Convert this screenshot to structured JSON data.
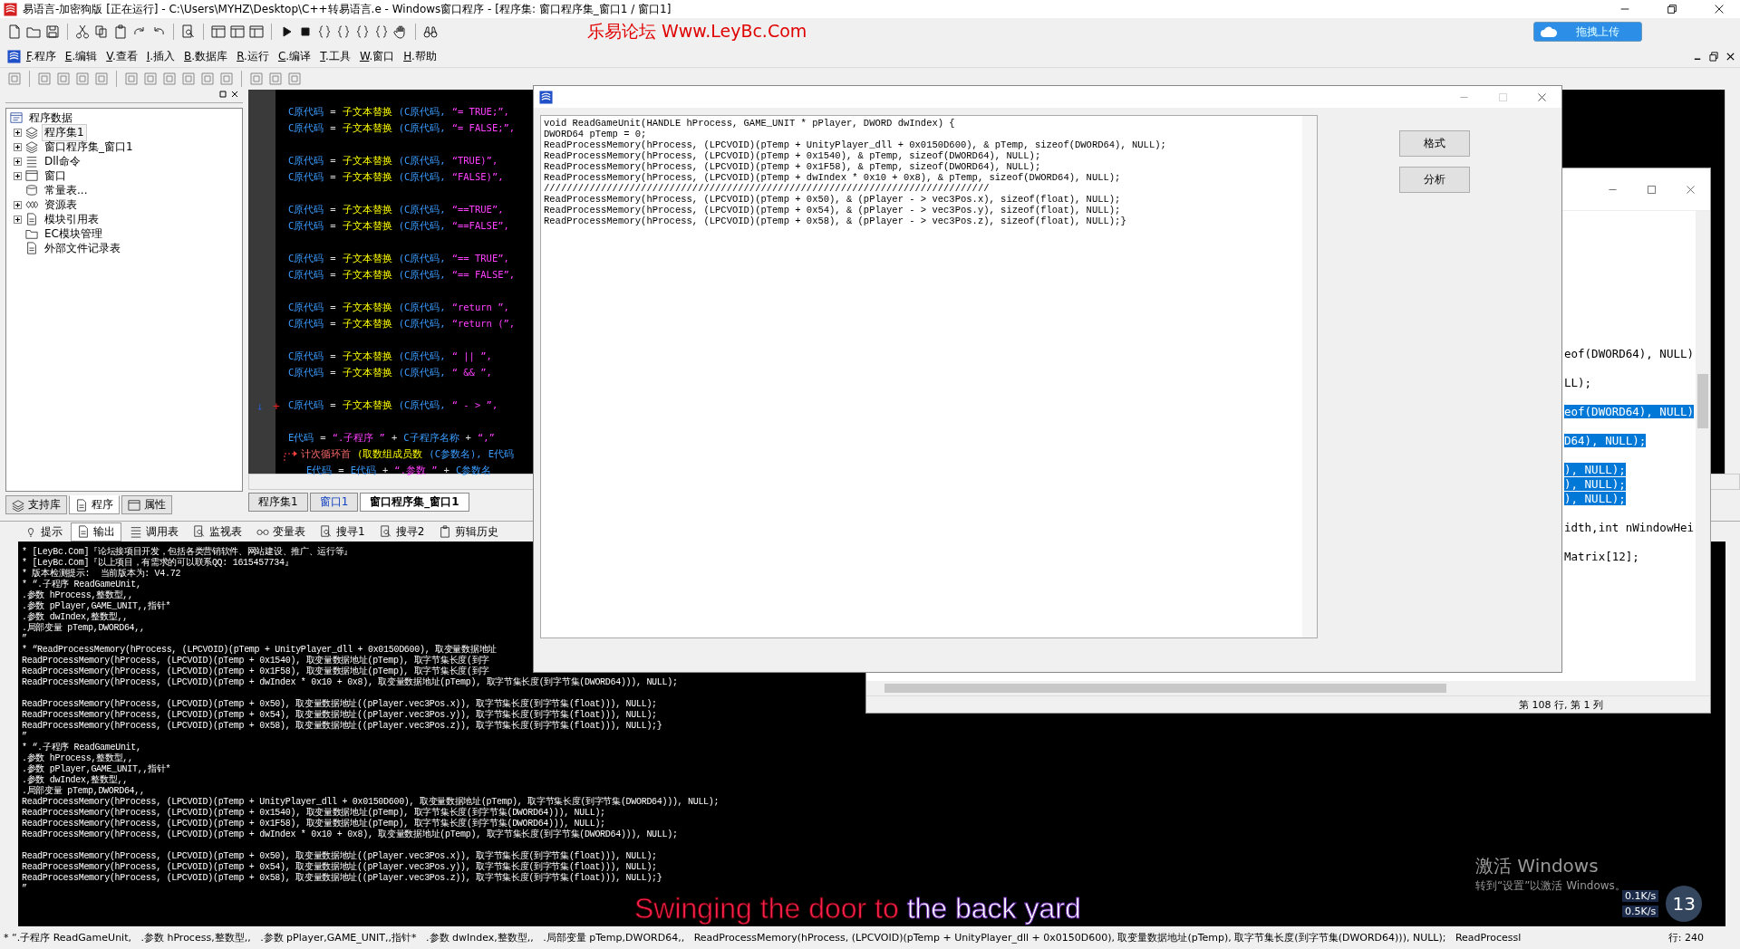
{
  "window": {
    "title": "易语言-加密狗版 [正在运行] - C:\\Users\\MYHZ\\Desktop\\C++转易语言.e - Windows窗口程序 - [程序集: 窗口程序集_窗口1 / 窗口1]"
  },
  "banner": "乐易论坛 Www.LeyBc.Com",
  "upload_button": "拖拽上传",
  "menu": [
    {
      "key": "F",
      "label": ".程序"
    },
    {
      "key": "E",
      "label": ".编辑"
    },
    {
      "key": "V",
      "label": ".查看"
    },
    {
      "key": "I",
      "label": ".插入"
    },
    {
      "key": "B",
      "label": ".数据库"
    },
    {
      "key": "R",
      "label": ".运行"
    },
    {
      "key": "C",
      "label": ".编译"
    },
    {
      "key": "T",
      "label": ".工具"
    },
    {
      "key": "W",
      "label": ".窗口"
    },
    {
      "key": "H",
      "label": ".帮助"
    }
  ],
  "tree": {
    "label": "程序数据",
    "expanded": true,
    "selected": false,
    "children": [
      {
        "label": "程序集1",
        "expanded": false,
        "selected": true
      },
      {
        "label": "窗口程序集_窗口1",
        "expanded": false,
        "selected": false
      },
      {
        "label": "Dll命令",
        "expanded": false,
        "selected": false
      },
      {
        "label": "窗口",
        "expanded": false,
        "selected": false
      },
      {
        "label": "常量表...",
        "selected": false
      },
      {
        "label": "资源表",
        "expanded": false,
        "selected": false
      },
      {
        "label": "模块引用表",
        "expanded": false,
        "selected": false
      },
      {
        "label": "EC模块管理",
        "selected": false
      },
      {
        "label": "外部文件记录表",
        "selected": false
      }
    ]
  },
  "panel_tabs": [
    {
      "label": "支持库",
      "selected": false
    },
    {
      "label": "程序",
      "selected": true
    },
    {
      "label": "属性",
      "selected": false
    }
  ],
  "code_blocks": [
    [
      {
        "kind": "plain",
        "tokens": [
          {
            "kind": "var",
            "text": "C原代码"
          },
          {
            "kind": "op",
            "text": "="
          },
          {
            "kind": "func",
            "text": "子文本替换"
          },
          {
            "kind": "var",
            "text": "(C原代码,"
          },
          {
            "kind": "str",
            "text": "“= TRUE;”,"
          }
        ]
      },
      {
        "kind": "plain",
        "tokens": [
          {
            "kind": "var",
            "text": "C原代码"
          },
          {
            "kind": "op",
            "text": "="
          },
          {
            "kind": "func",
            "text": "子文本替换"
          },
          {
            "kind": "var",
            "text": "(C原代码,"
          },
          {
            "kind": "str",
            "text": "“= FALSE;”,"
          }
        ]
      }
    ],
    [
      {
        "kind": "plain",
        "tokens": [
          {
            "kind": "var",
            "text": "C原代码"
          },
          {
            "kind": "op",
            "text": "="
          },
          {
            "kind": "func",
            "text": "子文本替换"
          },
          {
            "kind": "var",
            "text": "(C原代码,"
          },
          {
            "kind": "str",
            "text": "“TRUE)”,"
          }
        ]
      },
      {
        "kind": "plain",
        "tokens": [
          {
            "kind": "var",
            "text": "C原代码"
          },
          {
            "kind": "op",
            "text": "="
          },
          {
            "kind": "func",
            "text": "子文本替换"
          },
          {
            "kind": "var",
            "text": "(C原代码,"
          },
          {
            "kind": "str",
            "text": "“FALSE)”,"
          }
        ]
      }
    ],
    [
      {
        "kind": "plain",
        "tokens": [
          {
            "kind": "var",
            "text": "C原代码"
          },
          {
            "kind": "op",
            "text": "="
          },
          {
            "kind": "func",
            "text": "子文本替换"
          },
          {
            "kind": "var",
            "text": "(C原代码,"
          },
          {
            "kind": "str",
            "text": "“==TRUE”,"
          }
        ]
      },
      {
        "kind": "plain",
        "tokens": [
          {
            "kind": "var",
            "text": "C原代码"
          },
          {
            "kind": "op",
            "text": "="
          },
          {
            "kind": "func",
            "text": "子文本替换"
          },
          {
            "kind": "var",
            "text": "(C原代码,"
          },
          {
            "kind": "str",
            "text": "“==FALSE”,"
          }
        ]
      }
    ],
    [
      {
        "kind": "plain",
        "tokens": [
          {
            "kind": "var",
            "text": "C原代码"
          },
          {
            "kind": "op",
            "text": "="
          },
          {
            "kind": "func",
            "text": "子文本替换"
          },
          {
            "kind": "var",
            "text": "(C原代码,"
          },
          {
            "kind": "str",
            "text": "“== TRUE”,"
          }
        ]
      },
      {
        "kind": "plain",
        "tokens": [
          {
            "kind": "var",
            "text": "C原代码"
          },
          {
            "kind": "op",
            "text": "="
          },
          {
            "kind": "func",
            "text": "子文本替换"
          },
          {
            "kind": "var",
            "text": "(C原代码,"
          },
          {
            "kind": "str",
            "text": "“== FALSE”,"
          }
        ]
      }
    ],
    [
      {
        "kind": "plain",
        "tokens": [
          {
            "kind": "var",
            "text": "C原代码"
          },
          {
            "kind": "op",
            "text": "="
          },
          {
            "kind": "func",
            "text": "子文本替换"
          },
          {
            "kind": "var",
            "text": "(C原代码,"
          },
          {
            "kind": "str",
            "text": "“return ”,"
          }
        ]
      },
      {
        "kind": "plain",
        "tokens": [
          {
            "kind": "var",
            "text": "C原代码"
          },
          {
            "kind": "op",
            "text": "="
          },
          {
            "kind": "func",
            "text": "子文本替换"
          },
          {
            "kind": "var",
            "text": "(C原代码,"
          },
          {
            "kind": "str",
            "text": "“return (”,"
          }
        ]
      }
    ],
    [
      {
        "kind": "plain",
        "tokens": [
          {
            "kind": "var",
            "text": "C原代码"
          },
          {
            "kind": "op",
            "text": "="
          },
          {
            "kind": "func",
            "text": "子文本替换"
          },
          {
            "kind": "var",
            "text": "(C原代码,"
          },
          {
            "kind": "str",
            "text": "“ || ”,"
          }
        ]
      },
      {
        "kind": "plain",
        "tokens": [
          {
            "kind": "var",
            "text": "C原代码"
          },
          {
            "kind": "op",
            "text": "="
          },
          {
            "kind": "func",
            "text": "子文本替换"
          },
          {
            "kind": "var",
            "text": "(C原代码,"
          },
          {
            "kind": "str",
            "text": "“ && ”,"
          }
        ]
      }
    ],
    [
      {
        "kind": "plain",
        "markers": [
          {
            "kind": "arrow",
            "text": "↓"
          },
          {
            "kind": "plus",
            "text": "+"
          }
        ],
        "tokens": [
          {
            "kind": "var",
            "text": "C原代码"
          },
          {
            "kind": "op",
            "text": "="
          },
          {
            "kind": "func",
            "text": "子文本替换"
          },
          {
            "kind": "var",
            "text": "(C原代码,"
          },
          {
            "kind": "str",
            "text": "“ - > ”,"
          }
        ]
      }
    ],
    [
      {
        "kind": "plain",
        "tokens": [
          {
            "kind": "var",
            "text": "E代码"
          },
          {
            "kind": "op",
            "text": "="
          },
          {
            "kind": "str",
            "text": "“.子程序 ”"
          },
          {
            "kind": "op",
            "text": "+"
          },
          {
            "kind": "var",
            "text": "C子程序名称"
          },
          {
            "kind": "op",
            "text": "+"
          },
          {
            "kind": "str",
            "text": "“,”"
          }
        ]
      },
      {
        "kind": "loop",
        "tokens": [
          {
            "kind": "cmd",
            "text": "计次循环首"
          },
          {
            "kind": "func",
            "text": "(取数组成员数"
          },
          {
            "kind": "var",
            "text": "(C参数名),"
          },
          {
            "kind": "var",
            "text": "E代码"
          }
        ]
      },
      {
        "kind": "inner",
        "tokens": [
          {
            "kind": "var",
            "text": "E代码"
          },
          {
            "kind": "op",
            "text": "="
          },
          {
            "kind": "var",
            "text": "E代码"
          },
          {
            "kind": "op",
            "text": "+"
          },
          {
            "kind": "str",
            "text": "“.参数 ”"
          },
          {
            "kind": "op",
            "text": "+"
          },
          {
            "kind": "var",
            "text": "C参数名"
          }
        ]
      }
    ]
  ],
  "code_tabs": [
    {
      "label": "程序集1",
      "selected": false
    },
    {
      "label": "窗口1",
      "selected": false
    },
    {
      "label": "窗口程序集_窗口1",
      "selected": true
    }
  ],
  "output_tabs": [
    {
      "label": "提示",
      "selected": false
    },
    {
      "label": "输出",
      "selected": true
    },
    {
      "label": "调用表",
      "selected": false
    },
    {
      "label": "监视表",
      "selected": false
    },
    {
      "label": "变量表",
      "selected": false
    },
    {
      "label": "搜寻1",
      "selected": false
    },
    {
      "label": "搜寻2",
      "selected": false
    },
    {
      "label": "剪辑历史",
      "selected": false
    }
  ],
  "output_blocks": [
    [
      "* [LeyBc.Com]『论坛接项目开发，包括各类营销软件、网站建设、推广、运行等』",
      "* [LeyBc.Com]『以上项目，有需求的可以联系QQ: 1615457734』",
      "* 版本检测提示:  当前版本为: V4.72",
      "* “.子程序 ReadGameUnit,",
      ".参数 hProcess,整数型,,",
      ".参数 pPlayer,GAME_UNIT,,指针*",
      ".参数 dwIndex,整数型,,",
      ".局部变量 pTemp,DWORD64,,",
      "”",
      "* “ReadProcessMemory(hProcess, (LPCVOID)(pTemp + UnityPlayer_dll + 0x0150D600), 取变量数据地址",
      "ReadProcessMemory(hProcess, (LPCVOID)(pTemp + 0x1540), 取变量数据地址(pTemp), 取字节集长度(到字",
      "ReadProcessMemory(hProcess, (LPCVOID)(pTemp + 0x1F58), 取变量数据地址(pTemp), 取字节集长度(到字",
      "ReadProcessMemory(hProcess, (LPCVOID)(pTemp + dwIndex * 0x10 + 0x8), 取变量数据地址(pTemp), 取字节集长度(到字节集(DWORD64))), NULL);"
    ],
    [
      "ReadProcessMemory(hProcess, (LPCVOID)(pTemp + 0x50), 取变量数据地址((pPlayer.vec3Pos.x)), 取字节集长度(到字节集(float))), NULL);",
      "ReadProcessMemory(hProcess, (LPCVOID)(pTemp + 0x54), 取变量数据地址((pPlayer.vec3Pos.y)), 取字节集长度(到字节集(float))), NULL);",
      "ReadProcessMemory(hProcess, (LPCVOID)(pTemp + 0x58), 取变量数据地址((pPlayer.vec3Pos.z)), 取字节集长度(到字节集(float))), NULL);}",
      "”",
      "* “.子程序 ReadGameUnit,",
      ".参数 hProcess,整数型,,",
      ".参数 pPlayer,GAME_UNIT,,指针*",
      ".参数 dwIndex,整数型,,",
      ".局部变量 pTemp,DWORD64,,",
      "ReadProcessMemory(hProcess, (LPCVOID)(pTemp + UnityPlayer_dll + 0x0150D600), 取变量数据地址(pTemp), 取字节集长度(到字节集(DWORD64))), NULL);",
      "ReadProcessMemory(hProcess, (LPCVOID)(pTemp + 0x1540), 取变量数据地址(pTemp), 取字节集长度(到字节集(DWORD64))), NULL);",
      "ReadProcessMemory(hProcess, (LPCVOID)(pTemp + 0x1F58), 取变量数据地址(pTemp), 取字节集长度(到字节集(DWORD64))), NULL);",
      "ReadProcessMemory(hProcess, (LPCVOID)(pTemp + dwIndex * 0x10 + 0x8), 取变量数据地址(pTemp), 取字节集长度(到字节集(DWORD64))), NULL);"
    ],
    [
      "ReadProcessMemory(hProcess, (LPCVOID)(pTemp + 0x50), 取变量数据地址((pPlayer.vec3Pos.x)), 取字节集长度(到字节集(float))), NULL);",
      "ReadProcessMemory(hProcess, (LPCVOID)(pTemp + 0x54), 取变量数据地址((pPlayer.vec3Pos.y)), 取字节集长度(到字节集(float))), NULL);",
      "ReadProcessMemory(hProcess, (LPCVOID)(pTemp + 0x58), 取变量数据地址((pPlayer.vec3Pos.z)), 取字节集长度(到字节集(float))), NULL);}",
      "”"
    ]
  ],
  "status_line": "* “.子程序 ReadGameUnit,   .参数 hProcess,整数型,,   .参数 pPlayer,GAME_UNIT,,指针*   .参数 dwIndex,整数型,,   .局部变量 pTemp,DWORD64,,   ReadProcessMemory(hProcess, (LPCVOID)(pTemp + UnityPlayer_dll + 0x0150D600), 取变量数据地址(pTemp), 取字节集长度(到字节集(DWORD64))), NULL);   ReadProcessl",
  "status_position": "行: 240",
  "dialog": {
    "text_lines": [
      "void ReadGameUnit(HANDLE hProcess, GAME_UNIT * pPlayer, DWORD dwIndex) {",
      "DWORD64 pTemp = 0;",
      "ReadProcessMemory(hProcess, (LPCVOID)(pTemp + UnityPlayer_dll + 0x0150D600), & pTemp, sizeof(DWORD64), NULL);",
      "ReadProcessMemory(hProcess, (LPCVOID)(pTemp + 0x1540), & pTemp, sizeof(DWORD64), NULL);",
      "ReadProcessMemory(hProcess, (LPCVOID)(pTemp + 0x1F58), & pTemp, sizeof(DWORD64), NULL);",
      "ReadProcessMemory(hProcess, (LPCVOID)(pTemp + dwIndex * 0x10 + 0x8), & pTemp, sizeof(DWORD64), NULL);",
      "//////////////////////////////////////////////////////////////////////////////",
      "ReadProcessMemory(hProcess, (LPCVOID)(pTemp + 0x50), & (pPlayer - > vec3Pos.x), sizeof(float), NULL);",
      "ReadProcessMemory(hProcess, (LPCVOID)(pTemp + 0x54), & (pPlayer - > vec3Pos.y), sizeof(float), NULL);",
      "ReadProcessMemory(hProcess, (LPCVOID)(pTemp + 0x58), & (pPlayer - > vec3Pos.z), sizeof(float), NULL);}"
    ],
    "buttons": [
      "格式",
      "分析"
    ]
  },
  "editor_window": {
    "blocks": [
      [
        {
          "text": "eof(DWORD64), NULL)",
          "selected": false
        }
      ],
      [
        {
          "text": "LL);",
          "selected": false
        }
      ],
      [
        {
          "text": "eof(DWORD64), NULL)",
          "selected": true
        }
      ],
      [
        {
          "text": "D64), NULL);",
          "selected": true
        }
      ],
      [
        {
          "text": "), NULL);",
          "selected": true
        },
        {
          "text": "), NULL);",
          "selected": true
        },
        {
          "text": "), NULL);",
          "selected": true
        }
      ],
      [
        {
          "text": "idth,int nWindowHei",
          "selected": false
        }
      ],
      [
        {
          "text": "Matrix[12];",
          "selected": false
        }
      ]
    ],
    "status": "第 108 行, 第 1 列"
  },
  "subtitle": {
    "sung": "Swinging the door to",
    "pending": "the back yard"
  },
  "activation": {
    "title": "激活 Windows",
    "hint": "转到“设置”以激活 Windows。"
  },
  "net_speed": {
    "upload": "0.1K/s",
    "download": "0.5K/s",
    "badge": "13"
  }
}
